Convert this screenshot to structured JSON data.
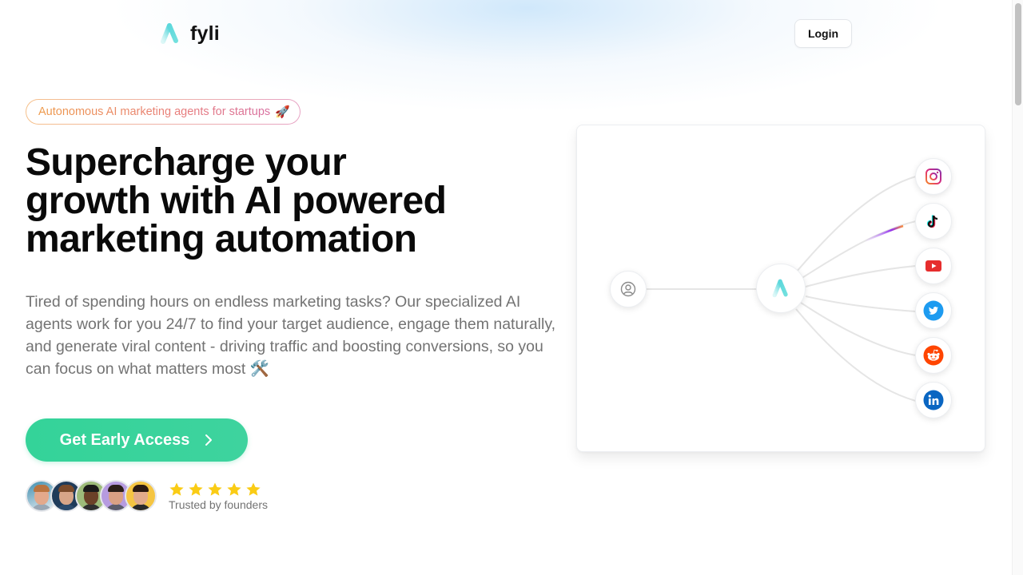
{
  "nav": {
    "brand_name": "fyli",
    "login_label": "Login"
  },
  "hero": {
    "badge_text": "Autonomous AI marketing agents for startups",
    "badge_emoji": "🚀",
    "headline_lines": [
      "Supercharge your",
      "growth with AI powered",
      "marketing automation"
    ],
    "subtext": "Tired of spending hours on endless marketing tasks? Our specialized AI agents work for you 24/7 to find your target audience, engage them naturally, and generate viral content - driving traffic and boosting conversions, so you can focus on what matters most 🛠️",
    "cta_label": "Get Early Access",
    "rating_stars": 5,
    "trusted_text": "Trusted by founders",
    "avatar_count": 5
  },
  "diagram": {
    "source_icon": "user-circle-icon",
    "hub_icon": "fyli-logo-icon",
    "channels": [
      {
        "name": "Instagram",
        "icon": "instagram-icon",
        "color": "#e1306c"
      },
      {
        "name": "TikTok",
        "icon": "tiktok-icon",
        "color": "#000000"
      },
      {
        "name": "YouTube",
        "icon": "youtube-icon",
        "color": "#e62d2d"
      },
      {
        "name": "Twitter",
        "icon": "twitter-icon",
        "color": "#1d9bf0"
      },
      {
        "name": "Reddit",
        "icon": "reddit-icon",
        "color": "#ff4500"
      },
      {
        "name": "LinkedIn",
        "icon": "linkedin-icon",
        "color": "#0a66c2"
      }
    ],
    "active_channel": "TikTok"
  },
  "colors": {
    "accent_green": "#34d399",
    "brand_teal": "#5fdcdc",
    "star_yellow": "#facc15",
    "text_muted": "#737373"
  }
}
